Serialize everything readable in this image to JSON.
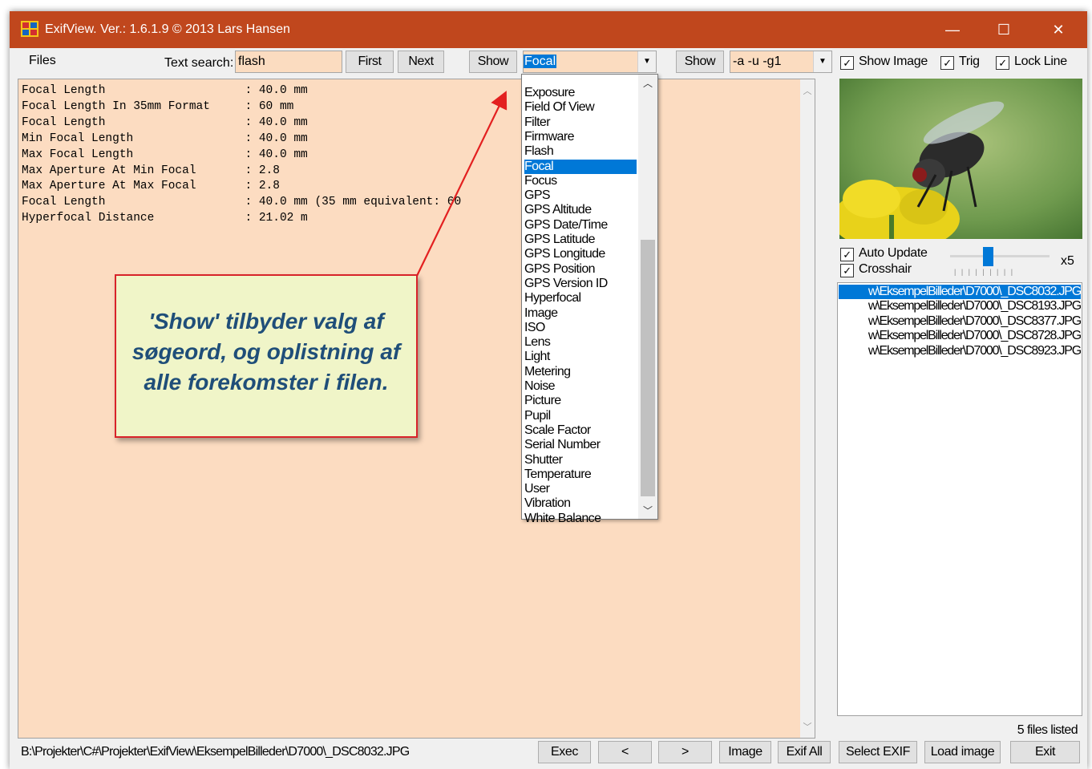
{
  "window": {
    "title": "ExifView. Ver.: 1.6.1.9 © 2013 Lars Hansen",
    "minimize": "—",
    "maximize": "☐",
    "close": "✕"
  },
  "toolbar": {
    "files_menu": "Files",
    "search_label": "Text search:",
    "search_value": "flash",
    "first_button": "First",
    "next_button": "Next",
    "show_button_1": "Show",
    "tag_combo_value": "Focal",
    "show_button_2": "Show",
    "args_combo_value": "-a -u -g1",
    "show_image_checkbox": "Show Image",
    "trig_checkbox": "Trig",
    "lock_line_checkbox": "Lock Line"
  },
  "output_lines": [
    "Focal Length                    : 40.0 mm",
    "Focal Length In 35mm Format     : 60 mm",
    "Focal Length                    : 40.0 mm",
    "Min Focal Length                : 40.0 mm",
    "Max Focal Length                : 40.0 mm",
    "Max Aperture At Min Focal       : 2.8",
    "Max Aperture At Max Focal       : 2.8",
    "Focal Length                    : 40.0 mm (35 mm equivalent: 60",
    "Hyperfocal Distance             : 21.02 m"
  ],
  "callout": {
    "line1": "'Show' tilbyder valg af",
    "line2": "søgeord, og oplistning af",
    "line3": "alle forekomster i filen."
  },
  "dropdown": {
    "items": [
      "Exposure",
      "Field Of View",
      "Filter",
      "Firmware",
      "Flash",
      "Focal",
      "Focus",
      "GPS",
      "GPS Altitude",
      "GPS Date/Time",
      "GPS Latitude",
      "GPS Longitude",
      "GPS Position",
      "GPS Version ID",
      "Hyperfocal",
      "Image",
      "ISO",
      "Lens",
      "Light",
      "Metering",
      "Noise",
      "Picture",
      "Pupil",
      "Scale Factor",
      "Serial Number",
      "Shutter",
      "Temperature",
      "User",
      "Vibration",
      "White Balance"
    ],
    "selected": "Focal"
  },
  "right_panel": {
    "auto_update_checkbox": "Auto Update",
    "crosshair_checkbox": "Crosshair",
    "zoom_label": "x5",
    "files": [
      "w\\EksempelBilleder\\D7000\\_DSC8032.JPG",
      "w\\EksempelBilleder\\D7000\\_DSC8193.JPG",
      "w\\EksempelBilleder\\D7000\\_DSC8377.JPG",
      "w\\EksempelBilleder\\D7000\\_DSC8728.JPG",
      "w\\EksempelBilleder\\D7000\\_DSC8923.JPG"
    ],
    "files_count": "5 files listed"
  },
  "bottom": {
    "path": "B:\\Projekter\\C#\\Projekter\\ExifView\\EksempelBilleder\\D7000\\_DSC8032.JPG",
    "exec_button": "Exec",
    "prev_button": "<",
    "next_button": ">",
    "image_button": "Image",
    "exif_all_button": "Exif All",
    "select_exif_button": "Select EXIF",
    "load_image_button": "Load image",
    "exit_button": "Exit"
  },
  "colors": {
    "titlebar": "#c0471d",
    "output_bg": "#fcdcc1",
    "selection": "#0078d7",
    "callout_text": "#1f4e79",
    "callout_border": "#d8232a"
  }
}
